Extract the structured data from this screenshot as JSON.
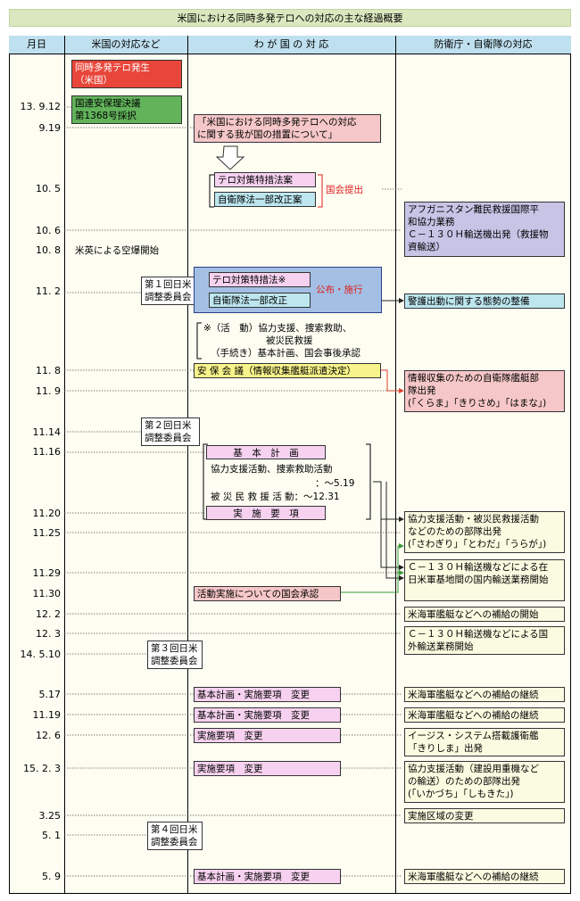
{
  "title": "米国における同時多発テロへの対応の主な経過概要",
  "headers": {
    "date": "月日",
    "us": "米国の対応など",
    "japan": "わ が 国 の 対 応",
    "jda": "防衛庁・自衛隊の対応"
  },
  "dates": {
    "d0912": "13. 9.12",
    "d0919": "9.19",
    "d1005": "10. 5",
    "d1006": "10. 6",
    "d1008": "10. 8",
    "d1102": "11. 2",
    "d1108": "11. 8",
    "d1109": "11. 9",
    "d1114": "11.14",
    "d1116": "11.16",
    "d1120": "11.20",
    "d1125": "11.25",
    "d1129": "11.29",
    "d1130": "11.30",
    "d1202": "12. 2",
    "d1203": "12. 3",
    "d140510": "14. 5.10",
    "d0517": "5.17",
    "d1119": "11.19",
    "d1206": "12. 6",
    "d150203": "15. 2. 3",
    "d0325": "3.25",
    "d0501": "5. 1",
    "d0509": "5. 9"
  },
  "us": {
    "attack_1": "同時多発テロ発生",
    "attack_2": "（米国）",
    "un_1": "国連安保理決議",
    "un_2": "第1368号採択",
    "airstrike": "米英による空爆開始",
    "council1_1": "第１回日米",
    "council1_2": "調整委員会",
    "council2_1": "第２回日米",
    "council2_2": "調整委員会",
    "council3_1": "第３回日米",
    "council3_2": "調整委員会",
    "council4_1": "第４回日米",
    "council4_2": "調整委員会"
  },
  "japan": {
    "measures_1": "「米国における同時多発テロへの対応",
    "measures_2": "に関する我が国の措置について」",
    "bill_antiterror": "テロ対策特措法案",
    "bill_sdf": "自衛隊法一部改正案",
    "submitted": "国会提出",
    "law_antiterror": "テロ対策特措法※",
    "law_sdf": "自衛隊法一部改正",
    "promulgated": "公布・施行",
    "note_1": "※（活　動）協力支援、捜索救助、",
    "note_2": "被災民救援",
    "note_3": "（手続き）基本計画、国会事後承認",
    "security_council": "安 保 会 議（情報収集艦艇派遣決定）",
    "basic_plan": "基　本　計　画",
    "activity_1": "協力支援活動、捜索救助活動",
    "activity_2": "：～5.19",
    "activity_3": "被 災 民 救 援 活 動：～12.31",
    "impl": "実　施　要　項",
    "diet_approval": "活動実施についての国会承認",
    "change_plan_impl": "基本計画・実施要項　変更",
    "change_impl": "実施要項　変更"
  },
  "jda": {
    "afghan_1": "アフガニスタン難民救援国際平",
    "afghan_2": "和協力業務",
    "afghan_3": "Ｃ－１３０Ｈ輸送機出発（救援物",
    "afghan_4": "資輸送）",
    "guard": "警護出動に関する態勢の整備",
    "intel_1": "情報収集のための自衛隊艦艇部",
    "intel_2": "隊出発",
    "intel_3": "(「くらま」「きりさめ」「はまな」)",
    "dispatch_1": "協力支援活動・被災民救援活動",
    "dispatch_2": "などのための部隊出発",
    "dispatch_3": "(「さわぎり」「とわだ」「うらが」)",
    "c130_1": "Ｃ－１３０Ｈ輸送機などによる在",
    "c130_2": "日米軍基地間の国内輸送業務開始",
    "supply_start": "米海軍艦艇などへの補給の開始",
    "c130int_1": "Ｃ－１３０Ｈ輸送機などによる国",
    "c130int_2": "外輸送業務開始",
    "supply_cont": "米海軍艦艇などへの補給の継続",
    "aegis_1": "イージス・システム搭載護衛艦",
    "aegis_2": "「きりしま」出発",
    "eng_1": "協力支援活動（建設用重機など",
    "eng_2": "の輸送）のための部隊出発",
    "eng_3": "(「いかづち」「しもきた」)",
    "area_change": "実施区域の変更"
  },
  "colors": {
    "title_bg": "#dbe8bf",
    "header_bg": "#bfe0ef",
    "red_box": "#e8463a",
    "green_box": "#62b35a",
    "pink_box": "#f6c7c8",
    "magenta_box": "#f7d2f0",
    "yellow_box": "#f8f38a",
    "cyan_box": "#bde6ef",
    "violet_box": "#c7c4e6",
    "cream_box": "#fbfbe1",
    "blue_box": "#a3bfe4"
  }
}
